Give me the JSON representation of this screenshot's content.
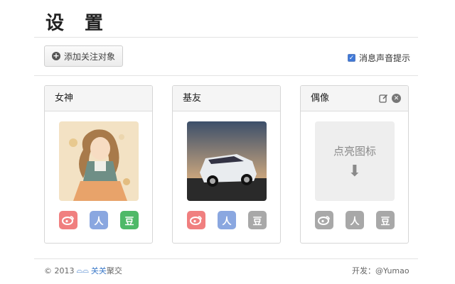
{
  "page": {
    "title": "设 置"
  },
  "toolbar": {
    "add_follow_label": "添加关注对象",
    "notify_label": "消息声音提示",
    "notify_checked": true
  },
  "cards": [
    {
      "title": "女神",
      "image": "anime-girl-illustration",
      "icons": [
        "weibo-icon",
        "renren-icon",
        "douban-icon"
      ],
      "active": true
    },
    {
      "title": "基友",
      "image": "white-car-photo",
      "icons": [
        "weibo-icon",
        "renren-icon",
        "douban-icon"
      ],
      "active": true
    },
    {
      "title": "偶像",
      "placeholder_text": "点亮图标",
      "placeholder_arrow": "⬇",
      "icons": [
        "weibo-icon",
        "renren-icon",
        "douban-icon"
      ],
      "active": false,
      "tools": [
        "edit-icon",
        "close-icon"
      ]
    }
  ],
  "icon_glyphs": {
    "douban": "豆",
    "renren": "人"
  },
  "colors": {
    "weibo": "#f07f7f",
    "renren": "#8aa7e0",
    "douban": "#4fb968",
    "inactive": "#a8a8a8",
    "link": "#3a78c8"
  },
  "footer": {
    "copyright": "© 2013",
    "brand_blue": "关关",
    "brand_rest": "聚交",
    "developer": "开发：@Yumao"
  }
}
